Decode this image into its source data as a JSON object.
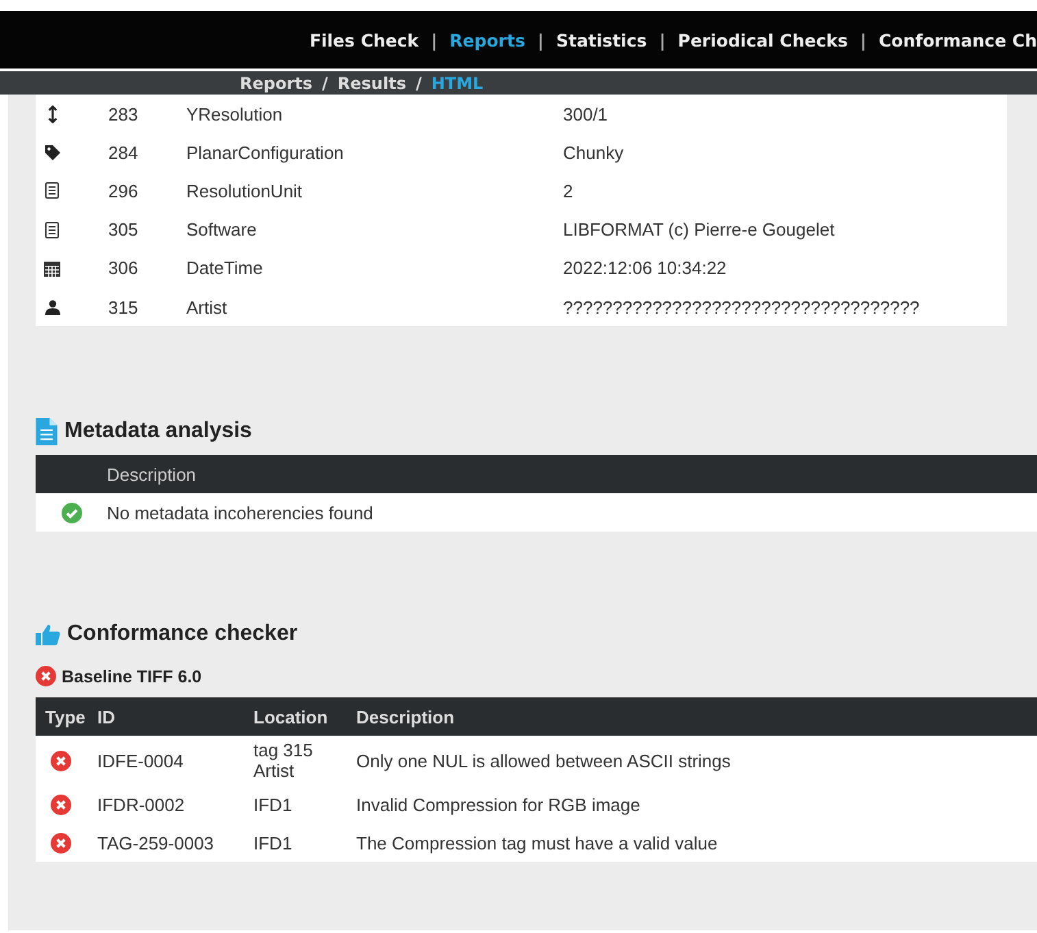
{
  "nav": {
    "items": [
      {
        "label": "Files Check",
        "selected": false
      },
      {
        "separator": "|",
        "label": "Reports",
        "selected": true
      },
      {
        "separator": "|",
        "label": "Statistics",
        "selected": false
      },
      {
        "separator": "|",
        "label": "Periodical Checks",
        "selected": false
      },
      {
        "separator": "|",
        "label": "Conformance Ch",
        "selected": false
      }
    ]
  },
  "breadcrumb": [
    {
      "label": "Reports",
      "selected": false
    },
    {
      "separator": "/",
      "label": "Results",
      "selected": false
    },
    {
      "separator": "/",
      "label": "HTML",
      "selected": true
    }
  ],
  "tags": [
    {
      "kind": "height",
      "id": "283",
      "name": "YResolution",
      "value": "300/1"
    },
    {
      "kind": "tag",
      "id": "284",
      "name": "PlanarConfiguration",
      "value": "Chunky"
    },
    {
      "kind": "doc",
      "id": "296",
      "name": "ResolutionUnit",
      "value": "2"
    },
    {
      "kind": "doc",
      "id": "305",
      "name": "Software",
      "value": "LIBFORMAT (c) Pierre-e Gougelet"
    },
    {
      "kind": "calendar",
      "id": "306",
      "name": "DateTime",
      "value": "2022:12:06 10:34:22"
    },
    {
      "kind": "user",
      "id": "315",
      "name": "Artist",
      "value": "????????????????????????????????????"
    }
  ],
  "metadata_analysis": {
    "title": "Metadata analysis",
    "columns": [
      "Description"
    ],
    "rows": [
      {
        "kind": "ok",
        "description": "No metadata incoherencies found"
      }
    ]
  },
  "conformance": {
    "title": "Conformance checker",
    "profile": {
      "kind": "error",
      "name": "Baseline TIFF 6.0"
    },
    "columns": [
      "Type",
      "ID",
      "Location",
      "Description"
    ],
    "rows": [
      {
        "kind": "error",
        "id": "IDFE-0004",
        "location": "tag 315 Artist",
        "description": "Only one NUL is allowed between ASCII strings"
      },
      {
        "kind": "error",
        "id": "IFDR-0002",
        "location": "IFD1",
        "description": "Invalid Compression for RGB image"
      },
      {
        "kind": "error",
        "id": "TAG-259-0003",
        "location": "IFD1",
        "description": "The Compression tag must have a valid value"
      }
    ]
  }
}
